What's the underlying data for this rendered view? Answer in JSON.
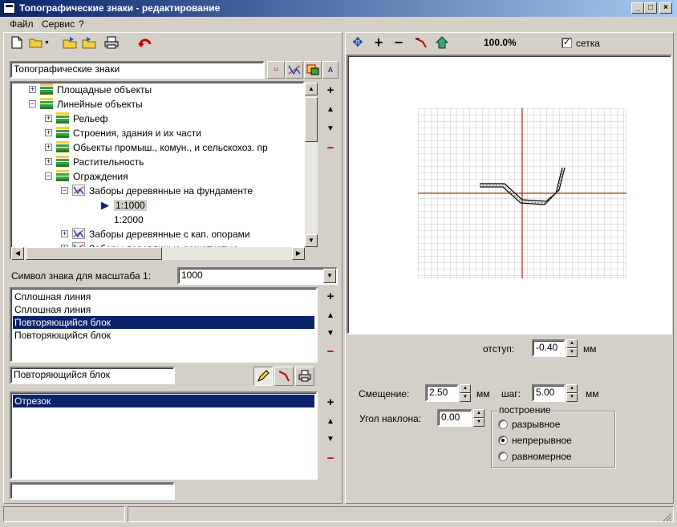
{
  "window": {
    "title": "Топографические знаки - редактирование"
  },
  "menu": {
    "file": "Файл",
    "service": "Сервис",
    "help": "?"
  },
  "tree_panel": {
    "header": "Топографические знаки",
    "nodes": [
      {
        "label": "Площадные объекты",
        "depth": 1,
        "expanded": false
      },
      {
        "label": "Линейные объекты",
        "depth": 1,
        "expanded": true
      },
      {
        "label": "Рельеф",
        "depth": 2,
        "expanded": false
      },
      {
        "label": "Строения, здания и их части",
        "depth": 2,
        "expanded": false
      },
      {
        "label": "Обьекты промыш., комун., и сельскохоз. пр",
        "depth": 2,
        "expanded": false
      },
      {
        "label": "Растительность",
        "depth": 2,
        "expanded": false
      },
      {
        "label": "Ограждения",
        "depth": 2,
        "expanded": true
      },
      {
        "label": "Заборы деревянные на фундаменте",
        "depth": 3,
        "expanded": true
      },
      {
        "label": "1:1000",
        "depth": 4,
        "selected": true
      },
      {
        "label": "1:2000",
        "depth": 4
      },
      {
        "label": "Заборы деревянные с кап. опорами",
        "depth": 3,
        "expanded": false
      },
      {
        "label": "Заборы деревянные решетчатые",
        "depth": 3,
        "expanded": false
      }
    ]
  },
  "scale_symbol": {
    "label": "Символ знака для масштаба 1:",
    "value": "1000"
  },
  "elements_list": {
    "items": [
      {
        "label": "Сплошная линия",
        "selected": false
      },
      {
        "label": "Сплошная линия",
        "selected": false
      },
      {
        "label": "Повторяющийся блок",
        "selected": true
      },
      {
        "label": "Повторяющийся блок",
        "selected": false
      }
    ],
    "current_name": "Повторяющийся блок"
  },
  "primitives_list": {
    "items": [
      {
        "label": "Отрезок",
        "selected": true
      }
    ],
    "current_name": ""
  },
  "preview": {
    "zoom": "100.0%",
    "grid_label": "сетка",
    "grid_checked": true
  },
  "params": {
    "indent_label": "отступ:",
    "indent_value": "-0.40",
    "indent_unit": "мм",
    "offset_label": "Смещение:",
    "offset_value": "2.50",
    "offset_unit": "мм",
    "step_label": "шаг:",
    "step_value": "5.00",
    "step_unit": "мм",
    "angle_label": "Угол наклона:",
    "angle_value": "0.00"
  },
  "construction": {
    "title": "построение",
    "options": [
      {
        "label": "разрывное",
        "checked": false
      },
      {
        "label": "непрерывное",
        "checked": true
      },
      {
        "label": "равномерное",
        "checked": false
      }
    ]
  },
  "colors": {
    "titlebar_start": "#0a246a",
    "titlebar_end": "#a6caf0",
    "selection": "#0a246a",
    "grid_axis": "#a00000",
    "remove_red": "#c00000"
  }
}
